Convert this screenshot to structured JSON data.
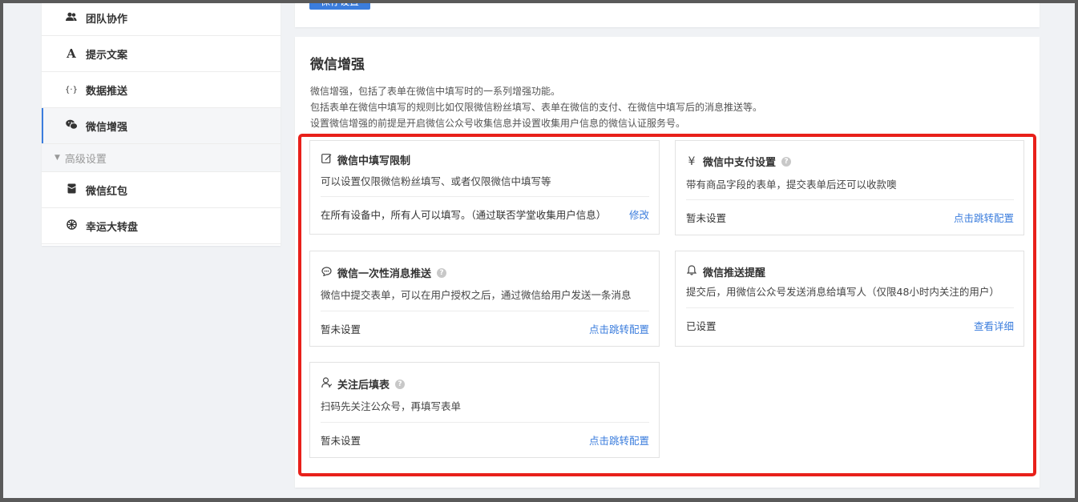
{
  "sidebar": {
    "items": [
      {
        "icon": "team-icon",
        "glyph": "👥",
        "label": "团队协作"
      },
      {
        "icon": "text-icon",
        "glyph": "A",
        "label": "提示文案"
      },
      {
        "icon": "code-braces-icon",
        "glyph": "{·}",
        "label": "数据推送"
      },
      {
        "icon": "wechat-icon",
        "glyph": "💬",
        "label": "微信增强",
        "active": true
      }
    ],
    "group_label": "高级设置",
    "advanced_items": [
      {
        "icon": "red-packet-icon",
        "glyph": "🧧",
        "label": "微信红包"
      },
      {
        "icon": "wheel-icon",
        "glyph": "✲",
        "label": "幸运大转盘"
      }
    ]
  },
  "toolbar": {
    "save_label": "保存设置"
  },
  "main": {
    "title": "微信增强",
    "desc_lines": [
      "微信增强，包括了表单在微信中填写时的一系列增强功能。",
      "包括表单在微信中填写的规则比如仅限微信粉丝填写、表单在微信的支付、在微信中填写后的消息推送等。",
      "设置微信增强的前提是开启微信公众号收集信息并设置收集用户信息的微信认证服务号。"
    ],
    "cards": [
      {
        "icon": "edit-icon",
        "title": "微信中填写限制",
        "help": false,
        "desc": "可以设置仅限微信粉丝填写、或者仅限微信中填写等",
        "status": "在所有设备中，所有人可以填写。（通过联否学堂收集用户信息）",
        "link": "修改"
      },
      {
        "icon": "yen-icon",
        "title": "微信中支付设置",
        "help": true,
        "desc": "带有商品字段的表单，提交表单后还可以收款噢",
        "status": "暂未设置",
        "link": "点击跳转配置"
      },
      {
        "icon": "message-icon",
        "title": "微信一次性消息推送",
        "help": true,
        "desc": "微信中提交表单，可以在用户授权之后，通过微信给用户发送一条消息",
        "status": "暂未设置",
        "link": "点击跳转配置"
      },
      {
        "icon": "bell-icon",
        "title": "微信推送提醒",
        "help": false,
        "desc": "提交后，用微信公众号发送消息给填写人（仅限48小时内关注的用户）",
        "status": "已设置",
        "link": "查看详细"
      },
      {
        "icon": "user-follow-icon",
        "title": "关注后填表",
        "help": true,
        "desc": "扫码先关注公众号，再填写表单",
        "status": "暂未设置",
        "link": "点击跳转配置"
      }
    ]
  },
  "colors": {
    "accent": "#3b7ddd",
    "highlight": "#e8201a",
    "background": "#f0f2f5"
  }
}
